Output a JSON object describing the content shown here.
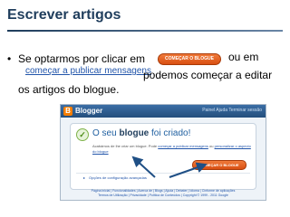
{
  "slide": {
    "title": "Escrever artigos",
    "bullet": "•",
    "line1_start": "Se optarmos por clicar em",
    "inline_button": "COMEÇAR O BLOGUE",
    "line1_end": "ou em",
    "inline_link": "começar a publicar mensagens",
    "line2_end": "podemos começar a editar",
    "line3": "os  artigos do blogue."
  },
  "blogger": {
    "logo_letter": "B",
    "brand": "Blogger",
    "header_links": "Painel Ajuda Terminar sessão",
    "check": "✓",
    "heading_pre": "O seu",
    "heading_bold": "blogue",
    "heading_post": "foi criado!",
    "desc_pre": "Acabámos de lhe criar um blogue. Pode",
    "desc_link1": "começar a publicar mensagens",
    "desc_mid": "ou",
    "desc_link2": "personalizar o aspecto do blogue",
    "start_button": "COMEÇAR O BLOGUE",
    "options_arrow": "▸",
    "options_link": "Opções de configuração avançadas",
    "footer_line1": "Página inicial | Funcionalidades | Acerca de | Blogs | Ajuda | Debater | Idioma | Cinforme de aplicações",
    "footer_line2": "Termos de Utilização | Privacidade | Política de Conteúdos | Copyright © 1999 - 2011 Google"
  },
  "colors": {
    "title": "#1f3d5c",
    "button": "#e0601e",
    "link": "#2255aa",
    "arrow": "#1f4f85"
  }
}
